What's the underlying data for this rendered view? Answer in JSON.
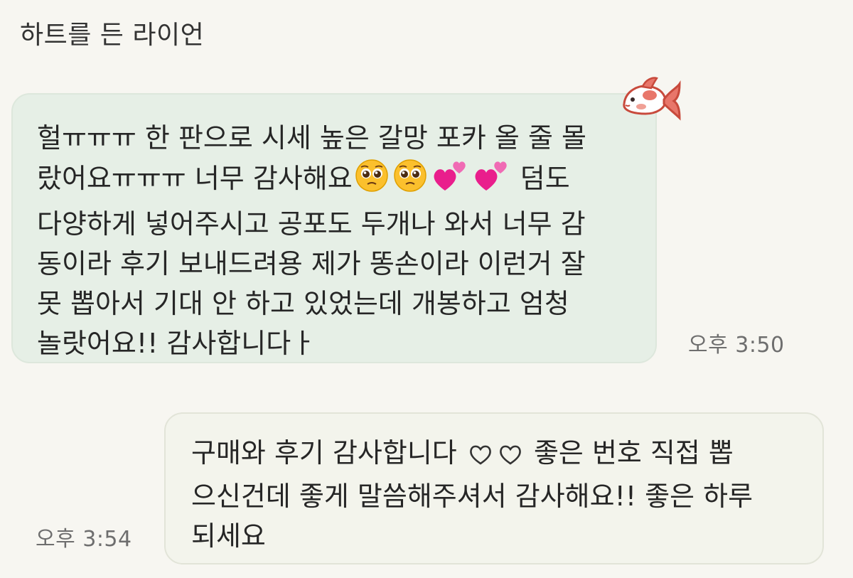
{
  "chat": {
    "sender_name": "하트를 든 라이언",
    "messages": [
      {
        "direction": "incoming",
        "text_part1": "헐ㅠㅠㅠ 한 판으로 시세 높은 갈망 포카 올 줄 몰\n랐어요ㅠㅠㅠ 너무 감사해요",
        "emoji_1": "pleading-face",
        "emoji_2": "pleading-face",
        "emoji_3": "two-hearts",
        "emoji_4": "two-hearts",
        "text_part2": " 덤도\n다양하게 넣어주시고 공포도 두개나 와서 너무 감\n동이라 후기 보내드려용 제가 똥손이라 이런거 잘\n못 뽑아서 기대 안 하고 있었는데 개봉하고 엄청\n놀랏어요!! 감사합니다ㅏ",
        "time": "오후 3:50",
        "sticker": "goldfish-sticker"
      },
      {
        "direction": "outgoing",
        "text_part1": "구매와 후기 감사합니다",
        "emoji_1": "heart-outline",
        "emoji_2": "heart-outline",
        "text_part2": " 좋은 번호 직접 뽑\n으신건데 좋게 말씀해주셔서 감사해요!! 좋은 하루\n되세요",
        "time": "오후 3:54"
      }
    ]
  },
  "colors": {
    "background": "#f7f6f1",
    "incoming_bubble": "#e6efe6",
    "outgoing_bubble": "#f3f4ec",
    "time_text": "#6e6e6e"
  }
}
